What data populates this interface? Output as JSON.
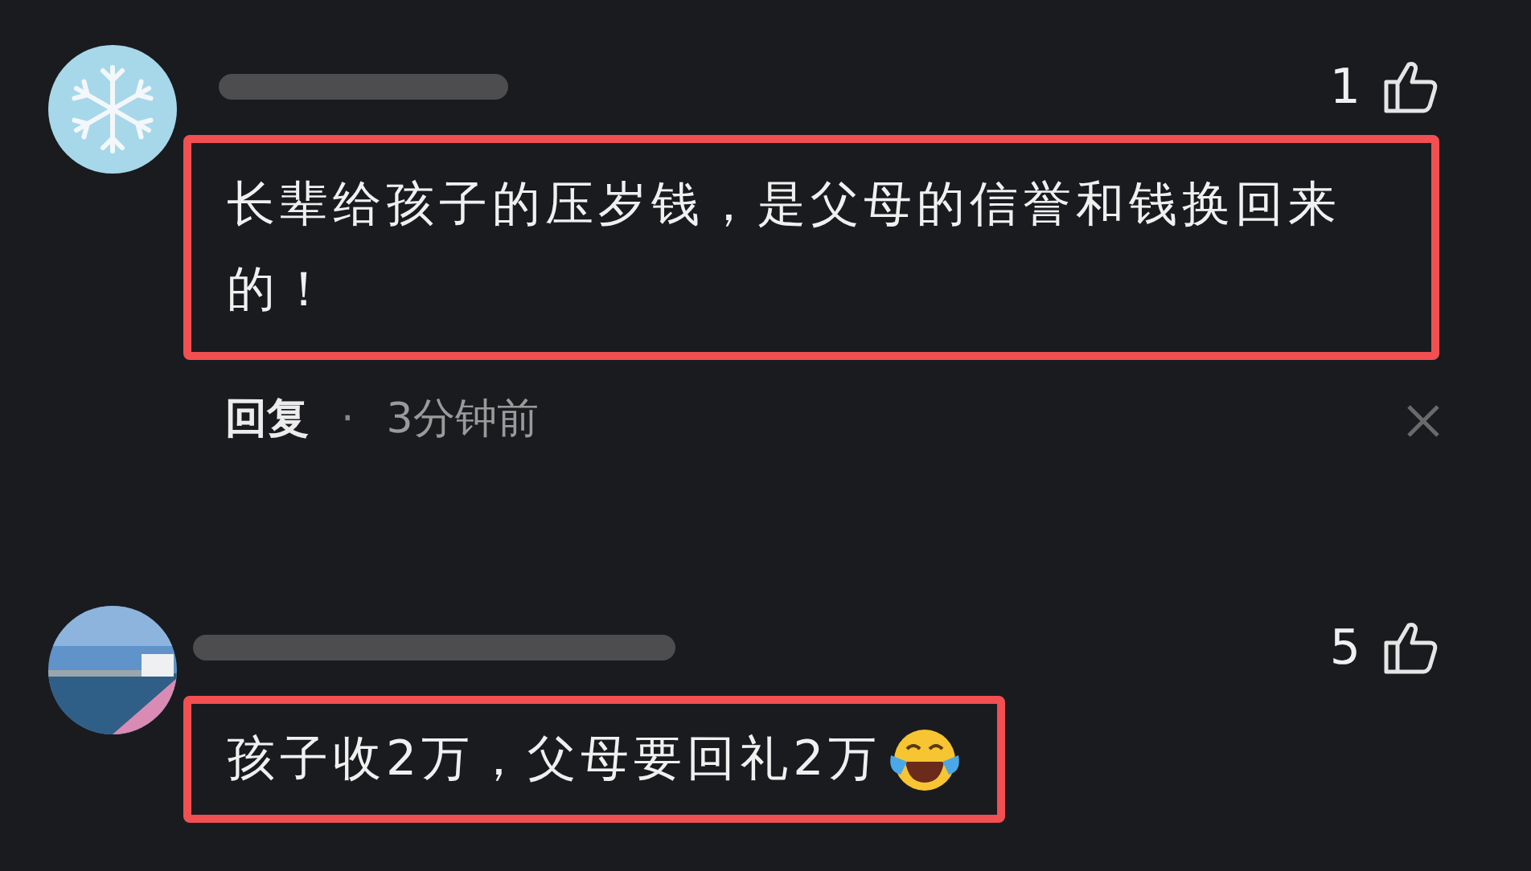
{
  "comments": [
    {
      "likes": "1",
      "text": "长辈给孩子的压岁钱，是父母的信誉和钱换回来的！",
      "highlighted": true,
      "reply_label": "回复",
      "separator": "·",
      "time": "3分钟前",
      "avatar": {
        "kind": "snowflake"
      }
    },
    {
      "likes": "5",
      "text": "孩子收2万，父母要回礼2万",
      "highlighted": true,
      "emoji": true
    }
  ]
}
